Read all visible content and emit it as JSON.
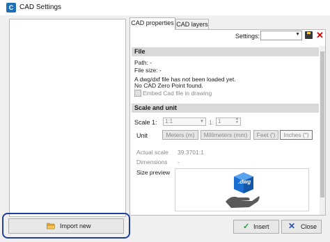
{
  "window": {
    "title": "CAD Settings"
  },
  "tabs": [
    {
      "label": "CAD properties"
    },
    {
      "label": "CAD layers"
    }
  ],
  "settings": {
    "label": "Settings:",
    "value": ""
  },
  "file_section": {
    "header": "File",
    "path": "Path: -",
    "file_size": "File size: -",
    "message1": "A dwg/dxf file has not been loaded yet.",
    "message2": "No CAD Zero Point found.",
    "embed_label": "Embed Cad file in drawing",
    "embed_checked": false
  },
  "scale_section": {
    "header": "Scale and unit",
    "scale_label": "Scale 1:",
    "scale_value": "1:1",
    "scale_value2": "1",
    "unit_label": "Unit",
    "units": [
      "Meters (m)",
      "Millimeters (mm)",
      "Feet (')",
      "Inches (\")"
    ],
    "selected_unit": "Inches (\")",
    "actual_scale_label": "Actual scale",
    "actual_scale_value": "39.3701:1",
    "dimensions_label": "Dimensions",
    "dimensions_value": "-",
    "size_preview_label": "Size preview",
    "preview_badge": ".dwg"
  },
  "buttons": {
    "import_new": "Import new",
    "insert": "Insert",
    "close": "Close"
  },
  "colors": {
    "highlight": "#1e3fa0",
    "dwg_blue": "#1a6fd1",
    "insert_check": "#1a9a3a",
    "close_x": "#1f4fb5"
  }
}
